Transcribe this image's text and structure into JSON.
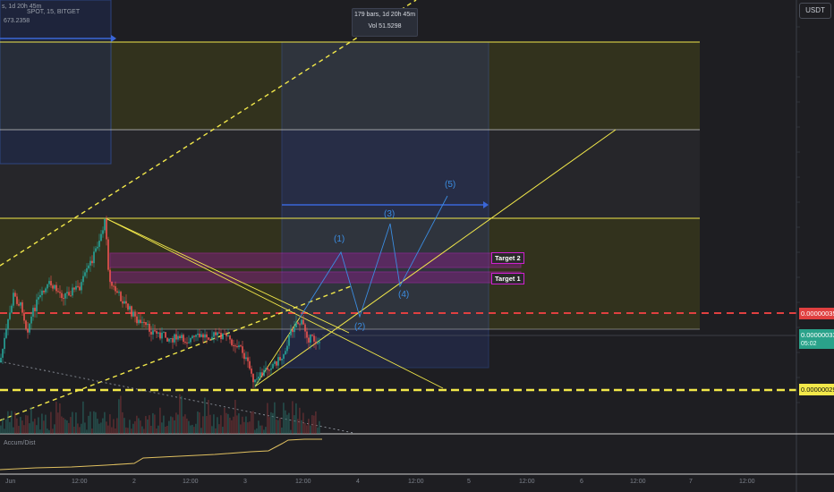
{
  "header": {
    "title_fragment": "s, 1d 20h 45m",
    "symbol_fragment": "SPOT, 15, BITGET",
    "value_fragment": "673.2358"
  },
  "tooltip": {
    "line1": "179 bars, 1d 20h 45m",
    "line2": "Vol 51.5298"
  },
  "price_axis": {
    "unit": "USDT",
    "red_level": "0.00000035",
    "current_price": "0.00000033",
    "countdown": "05:02",
    "yellow_level": "0.00000029"
  },
  "targets": {
    "target2": "Target 2",
    "target1": "Target 1"
  },
  "wave_labels": [
    "(1)",
    "(2)",
    "(3)",
    "(4)",
    "(5)"
  ],
  "indicator": {
    "name": "Accum/Dist"
  },
  "time_axis": [
    "Jun",
    "12:00",
    "2",
    "12:00",
    "3",
    "12:00",
    "4",
    "12:00",
    "5",
    "12:00",
    "6",
    "12:00",
    "7",
    "12:00",
    "12:00"
  ],
  "colors": {
    "background": "#1e1e22",
    "yellow": "#f2e84a",
    "blue": "#3a66d8",
    "red": "#e04040",
    "green": "#26a69a",
    "candle_red": "#ef5350",
    "magenta": "#d020d0",
    "wave_blue": "#3b8ce0"
  }
}
